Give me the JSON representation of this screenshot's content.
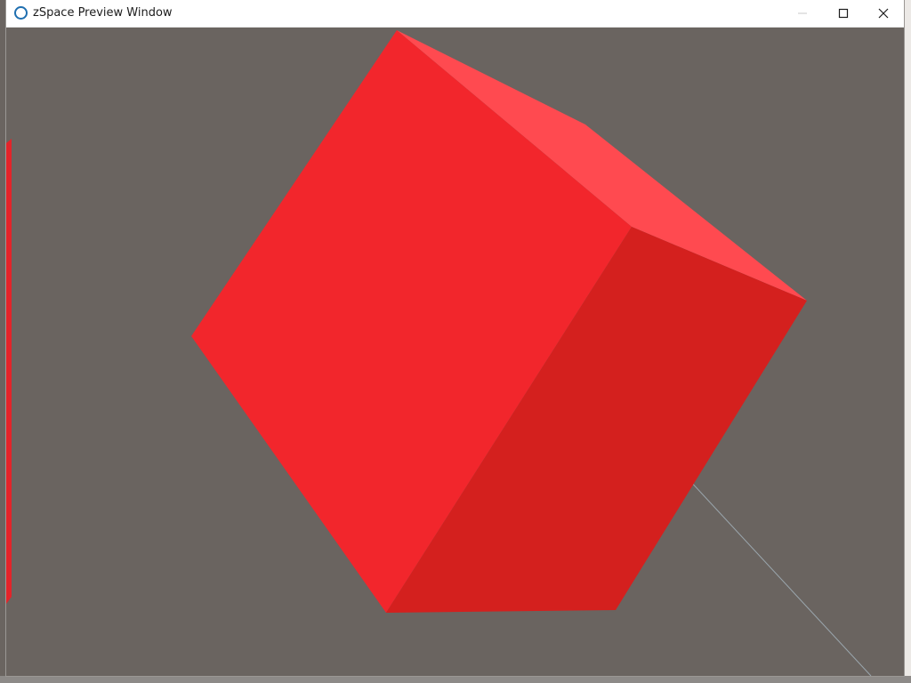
{
  "window": {
    "title": "zSpace Preview Window",
    "controls": {
      "minimize_icon": "minimize-icon",
      "maximize_icon": "maximize-icon",
      "close_icon": "close-icon"
    }
  },
  "scene": {
    "background_color": "#6a6460",
    "object": {
      "shape": "cube",
      "front_face_color": "#f2262c",
      "right_face_color": "#d4201e",
      "top_face_color": "#ff4a50"
    },
    "stylus_beam_color": "#9aa6ad"
  }
}
